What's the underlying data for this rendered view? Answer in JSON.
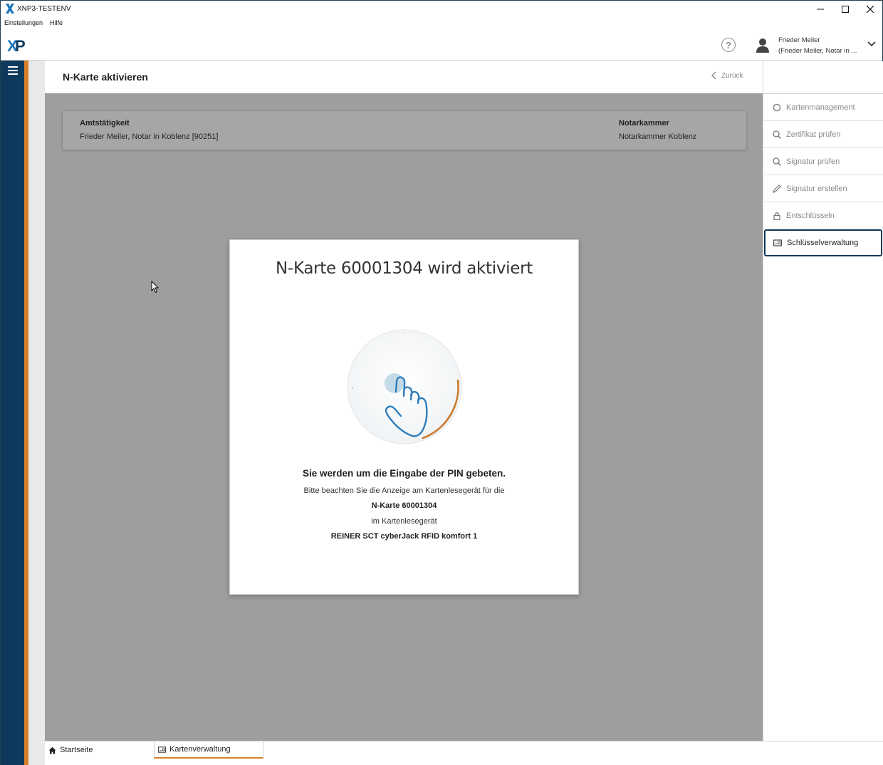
{
  "window": {
    "title": "XNP3-TESTENV",
    "minimize_icon": "minimize-icon",
    "maximize_icon": "maximize-icon",
    "close_icon": "close-icon"
  },
  "menu": {
    "items": [
      "Einstellungen",
      "Hilfe"
    ]
  },
  "header": {
    "logo": "XNP",
    "user_name": "Frieder Meiler",
    "user_sub": "(Frieder Meiler, Notar in ..."
  },
  "page": {
    "title": "N-Karte aktivieren",
    "back_label": "Zurück"
  },
  "info": {
    "amt_label": "Amtstätigkeit",
    "amt_value": "Frieder Meiler, Notar in Koblenz [90251]",
    "kammer_label": "Notarkammer",
    "kammer_value": "Notarkammer Koblenz"
  },
  "modal": {
    "title": "N-Karte 60001304 wird aktiviert",
    "heading": "Sie werden um die Eingabe der PIN gebeten.",
    "line1": "Bitte beachten Sie die Anzeige am Kartenlesegerät für die",
    "line2": "N-Karte 60001304",
    "line3": "im Kartenlesegerät",
    "line4": "REINER SCT cyberJack RFID komfort 1"
  },
  "sidebar": {
    "items": [
      {
        "label": "Kartenmanagement",
        "icon": "circle-icon"
      },
      {
        "label": "Zertifikat prüfen",
        "icon": "search-icon"
      },
      {
        "label": "Signatur prüfen",
        "icon": "search-icon"
      },
      {
        "label": "Signatur erstellen",
        "icon": "pen-icon"
      },
      {
        "label": "Entschlüsseln",
        "icon": "lock-icon"
      },
      {
        "label": "Schlüsselverwaltung",
        "icon": "card-icon"
      }
    ]
  },
  "tabs": [
    {
      "label": "Startseite",
      "icon": "home-icon"
    },
    {
      "label": "Kartenverwaltung",
      "icon": "card-icon"
    }
  ],
  "colors": {
    "nav": "#0d3a5c",
    "accent": "#d9802a",
    "overlay": "#9e9e9e"
  }
}
